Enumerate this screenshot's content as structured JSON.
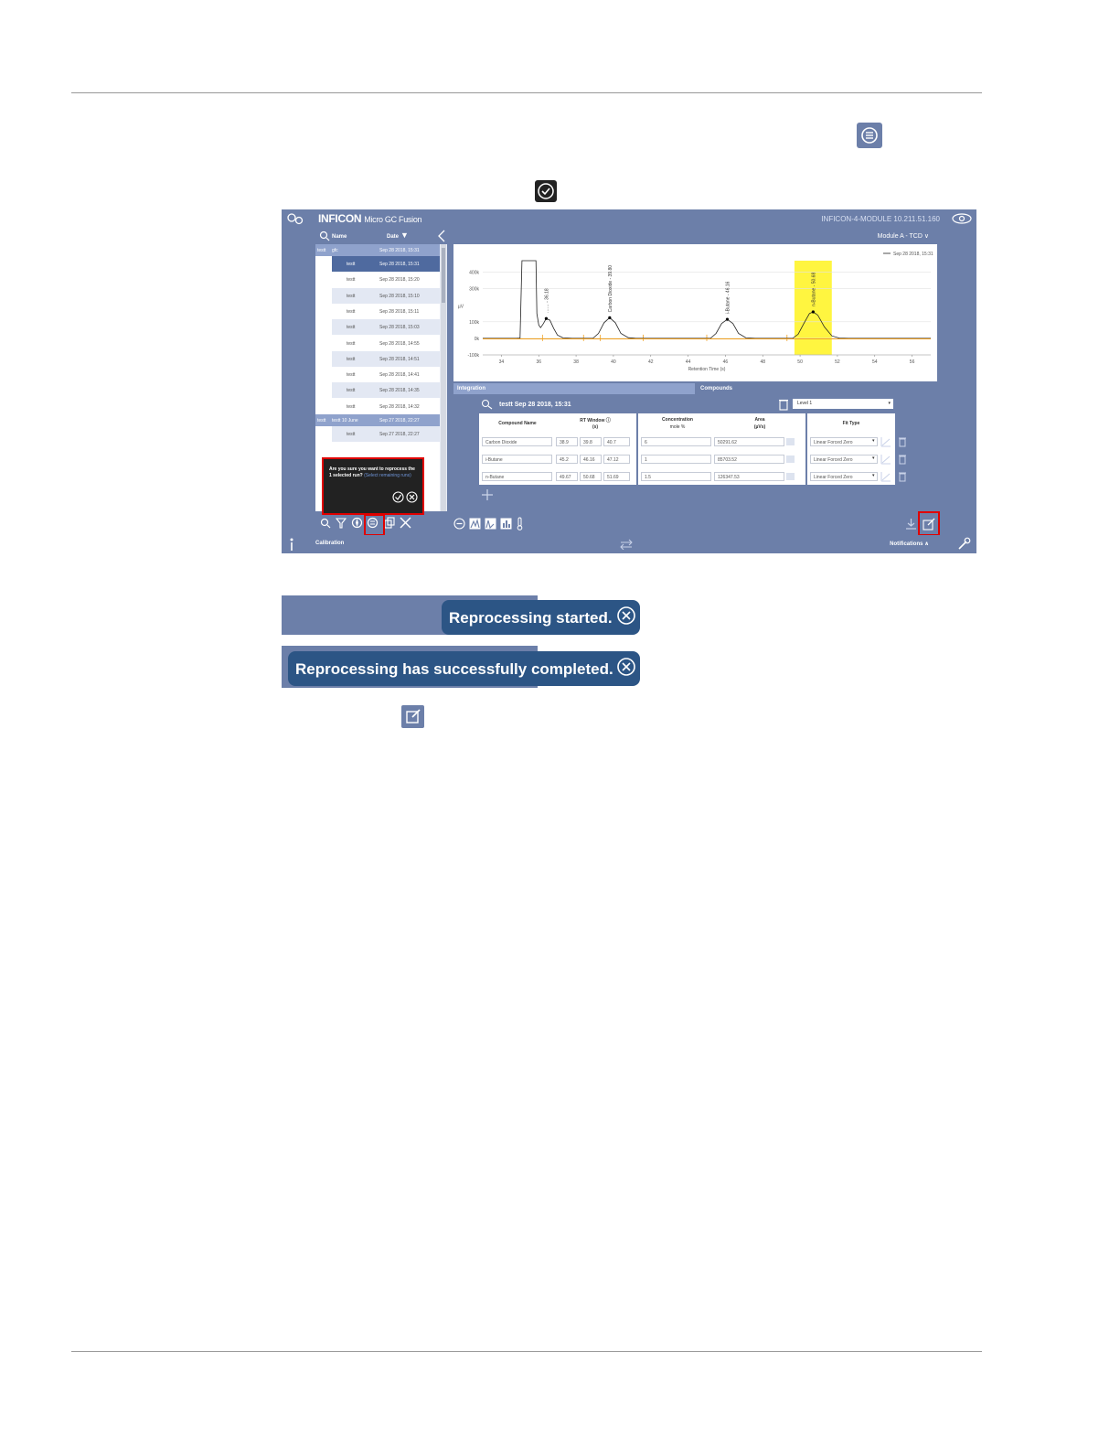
{
  "app": {
    "brand": "INFICON",
    "product": "Micro GC Fusion",
    "hostname": "INFICON-4-MODULE 10.211.51.160",
    "module_select": "Module A - TCD"
  },
  "run_list": {
    "headers": {
      "name": "Name",
      "date": "Date"
    },
    "groups": [
      {
        "label": "testt",
        "name": "gfc",
        "date": "Sep 28 2018, 15:31"
      },
      {
        "label": "testt",
        "name": "testt 10 June",
        "date": "Sep 27 2018, 22:27"
      }
    ],
    "rows": [
      {
        "name": "testt",
        "date": "Sep 28 2018, 15:31",
        "selected": true
      },
      {
        "name": "testt",
        "date": "Sep 28 2018, 15:20"
      },
      {
        "name": "testt",
        "date": "Sep 28 2018, 15:10"
      },
      {
        "name": "testt",
        "date": "Sep 28 2018, 15:11"
      },
      {
        "name": "testt",
        "date": "Sep 28 2018, 15:03"
      },
      {
        "name": "testt",
        "date": "Sep 28 2018, 14:55"
      },
      {
        "name": "testt",
        "date": "Sep 28 2018, 14:51"
      },
      {
        "name": "testt",
        "date": "Sep 28 2018, 14:41"
      },
      {
        "name": "testt",
        "date": "Sep 28 2018, 14:35"
      },
      {
        "name": "testt",
        "date": "Sep 28 2018, 14:32"
      }
    ],
    "row_after_group2": {
      "name": "testt",
      "date": "Sep 27 2018, 22:27"
    }
  },
  "confirm_popup": {
    "text": "Are you sure you want to reprocess the 1 selected run?",
    "link": "(Select remaining runs)"
  },
  "chart_data": {
    "type": "line",
    "legend": "Sep 28 2018, 15:31",
    "xlabel": "Retention Time (s)",
    "ylabel": "µV",
    "xlim": [
      33,
      57
    ],
    "ylim": [
      -100000,
      470000
    ],
    "x_ticks": [
      34,
      36,
      38,
      40,
      42,
      44,
      46,
      48,
      50,
      52,
      54,
      56
    ],
    "y_ticks": [
      {
        "value": 400000,
        "label": "400k"
      },
      {
        "value": 300000,
        "label": "300k"
      },
      {
        "value": 100000,
        "label": "100k"
      },
      {
        "value": 0,
        "label": "0k"
      },
      {
        "value": -100000,
        "label": "-100k"
      }
    ],
    "peaks": [
      {
        "label": "…… - 36.18",
        "x": 36.4,
        "y": 120000
      },
      {
        "label": "Carbon Dioxide - 39.80",
        "x": 39.8,
        "y": 125000
      },
      {
        "label": "i-Butane - 46.16",
        "x": 46.1,
        "y": 115000
      },
      {
        "label": "n-Butane - 50.68",
        "x": 50.7,
        "y": 160000
      }
    ],
    "highlight_range": [
      49.7,
      51.7
    ],
    "series": [
      {
        "color": "#222222",
        "points": [
          [
            33,
            0
          ],
          [
            34.8,
            0
          ],
          [
            35.0,
            2000
          ],
          [
            35.1,
            470000
          ],
          [
            35.85,
            470000
          ],
          [
            35.9,
            150000
          ],
          [
            36.0,
            80000
          ],
          [
            36.1,
            65000
          ],
          [
            36.25,
            90000
          ],
          [
            36.4,
            120000
          ],
          [
            36.6,
            110000
          ],
          [
            36.8,
            60000
          ],
          [
            37.0,
            20000
          ],
          [
            37.3,
            3000
          ],
          [
            37.8,
            0
          ],
          [
            38.9,
            0
          ],
          [
            39.2,
            30000
          ],
          [
            39.5,
            95000
          ],
          [
            39.8,
            125000
          ],
          [
            40.1,
            95000
          ],
          [
            40.4,
            30000
          ],
          [
            40.8,
            4000
          ],
          [
            41.2,
            0
          ],
          [
            45.2,
            0
          ],
          [
            45.5,
            30000
          ],
          [
            45.8,
            90000
          ],
          [
            46.1,
            115000
          ],
          [
            46.4,
            90000
          ],
          [
            46.7,
            30000
          ],
          [
            47.1,
            3000
          ],
          [
            47.6,
            0
          ],
          [
            49.6,
            0
          ],
          [
            49.9,
            25000
          ],
          [
            50.2,
            90000
          ],
          [
            50.5,
            150000
          ],
          [
            50.7,
            160000
          ],
          [
            50.95,
            140000
          ],
          [
            51.3,
            70000
          ],
          [
            51.7,
            15000
          ],
          [
            52.1,
            2000
          ],
          [
            52.6,
            0
          ],
          [
            57,
            0
          ]
        ]
      },
      {
        "color": "#f0a020",
        "points": [
          [
            33,
            -3000
          ],
          [
            57,
            -3000
          ]
        ]
      }
    ]
  },
  "tabs": {
    "integration": "Integration",
    "compounds": "Compounds"
  },
  "compounds": {
    "run_title": "testt Sep 28 2018, 15:31",
    "level": "Level 1",
    "headers": {
      "compound_name": "Compound Name",
      "rt_window": "RT Window",
      "rt_unit": "(s)",
      "concentration": "Concentration",
      "conc_unit": "mole %",
      "area": "Area",
      "area_unit": "(µVs)",
      "fit_type": "Fit Type"
    },
    "rows": [
      {
        "name": "Carbon Dioxide",
        "rt_start": "38.9",
        "rt_mid": "39.8",
        "rt_end": "40.7",
        "concentration": "6",
        "area": "50291.62",
        "fit": "Linear Forced Zero"
      },
      {
        "name": "i-Butane",
        "rt_start": "45.2",
        "rt_mid": "46.16",
        "rt_end": "47.12",
        "concentration": "1",
        "area": "85703.52",
        "fit": "Linear Forced Zero"
      },
      {
        "name": "n-Butane",
        "rt_start": "49.67",
        "rt_mid": "50.68",
        "rt_end": "51.69",
        "concentration": "1.5",
        "area": "126347.53",
        "fit": "Linear Forced Zero"
      }
    ]
  },
  "bottombar": {
    "left": "Calibration",
    "right": "Notifications"
  },
  "toasts": {
    "started": "Reprocessing started.",
    "completed": "Reprocessing has successfully completed."
  }
}
